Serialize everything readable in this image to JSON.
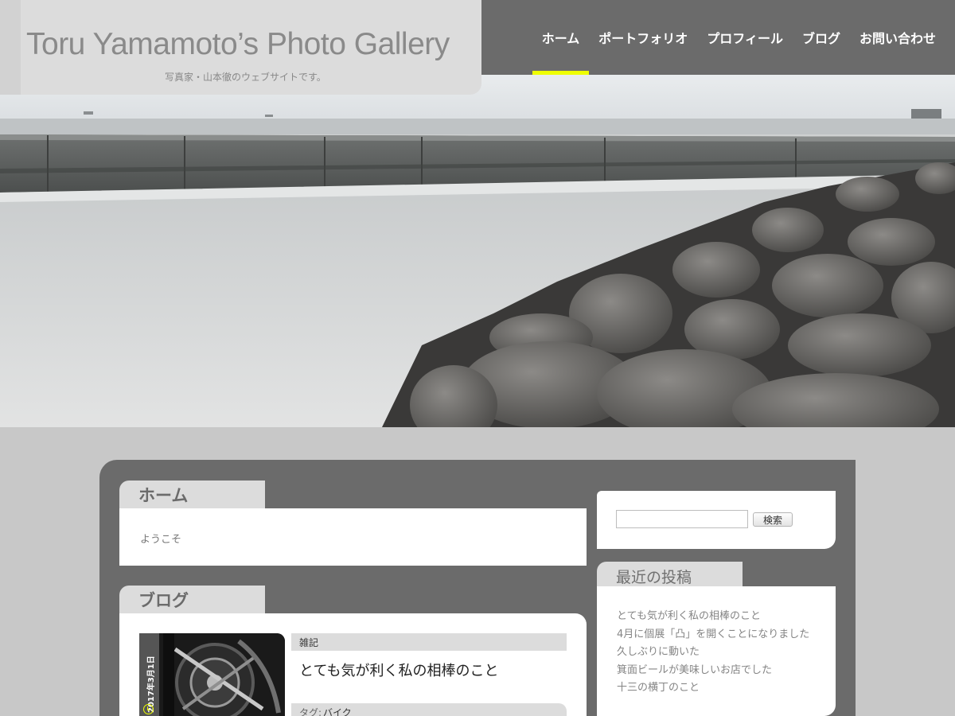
{
  "site": {
    "title": "Toru Yamamoto’s Photo Gallery",
    "description": "写真家・山本徹のウェブサイトです。"
  },
  "nav": {
    "items": [
      {
        "label": "ホーム",
        "active": true
      },
      {
        "label": "ポートフォリオ",
        "active": false
      },
      {
        "label": "プロフィール",
        "active": false
      },
      {
        "label": "ブログ",
        "active": false
      },
      {
        "label": "お問い合わせ",
        "active": false
      }
    ]
  },
  "home": {
    "heading": "ホーム",
    "text": "ようこそ"
  },
  "blog": {
    "heading": "ブログ",
    "post": {
      "date": "2017年3月1日",
      "category": "雑記",
      "title": "とても気が利く私の相棒のこと",
      "tags_label": "タグ:",
      "tag": "バイク"
    }
  },
  "search": {
    "button_label": "検索",
    "value": ""
  },
  "recent": {
    "heading": "最近の投稿",
    "items": [
      "とても気が利く私の相棒のこと",
      "4月に個展「凸」を開くことになりました",
      "久しぶりに動いた",
      "箕面ビールが美味しいお店でした",
      "十三の横丁のこと"
    ]
  },
  "colors": {
    "accent": "#eeff00",
    "header_dark": "#6b6b6b",
    "branding_bg": "#dcdcdc",
    "page_bg": "#c8c8c8"
  }
}
